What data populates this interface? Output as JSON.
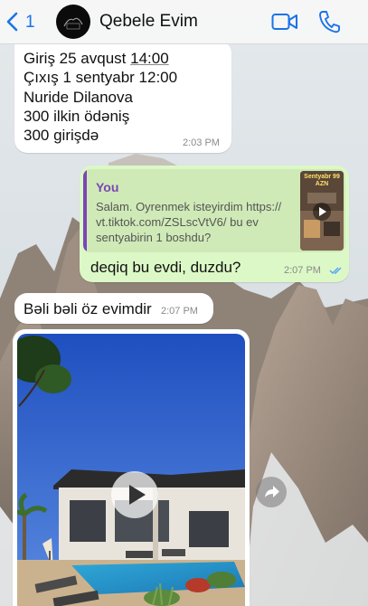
{
  "header": {
    "unread_count": "1",
    "title": "Qebele Evim"
  },
  "messages": [
    {
      "direction": "incoming",
      "lines": [
        "Giriş 25 avqust 14:00",
        "Çıxış 1 sentyabr 12:00",
        "Nuride Dilanova",
        "300 ilkin ödəniş",
        "300 girişdə"
      ],
      "time": "2:03 PM"
    },
    {
      "direction": "outgoing",
      "quote": {
        "author": "You",
        "lines": [
          "Salam. Oyrenmek isteyirdim https://",
          "vt.tiktok.com/ZSLscVtV6/ bu ev",
          "sentyabirin 1 boshdu?"
        ],
        "thumbnail_label": "Sentyabr 99 AZN"
      },
      "text": "deqiq bu evdi, duzdu?",
      "time": "2:07 PM",
      "status": "read"
    },
    {
      "direction": "incoming",
      "text": "Bəli bəli öz evimdir",
      "time": "2:07 PM"
    },
    {
      "direction": "incoming",
      "type": "video"
    }
  ],
  "colors": {
    "accent": "#1a73e8",
    "outgoing_bubble": "#dcf8c6",
    "quote_author": "#7b46b5",
    "read_ticks": "#4fa3f7"
  },
  "icons": [
    "chevron-left-icon",
    "video-call-icon",
    "phone-icon",
    "play-icon",
    "forward-icon",
    "double-check-icon"
  ]
}
